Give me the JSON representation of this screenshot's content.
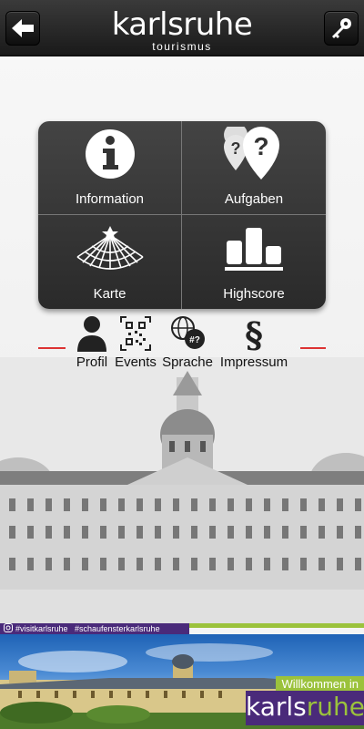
{
  "header": {
    "back_icon": "arrow-left-icon",
    "logo_main": "karlsruhe",
    "logo_sub": "tourismus",
    "key_icon": "key-icon"
  },
  "menu": {
    "tiles": [
      {
        "label": "Information",
        "icon": "info-icon"
      },
      {
        "label": "Aufgaben",
        "icon": "question-pins-icon"
      },
      {
        "label": "Karte",
        "icon": "fan-map-icon"
      },
      {
        "label": "Highscore",
        "icon": "podium-icon"
      }
    ]
  },
  "iconrow": {
    "items": [
      {
        "label": "Profil",
        "icon": "person-icon"
      },
      {
        "label": "Events",
        "icon": "qr-code-icon"
      },
      {
        "label": "Sprache",
        "icon": "language-globe-icon"
      },
      {
        "label": "Impressum",
        "icon": "section-sign-icon"
      }
    ]
  },
  "social": {
    "hashtags": "#visitkarlsruhe   #schaufensterkarlsruhe",
    "instagram_icon": "instagram-icon"
  },
  "banner": {
    "welcome": "Willkommen in",
    "brand_part1": "karls",
    "brand_part2": "ruhe"
  },
  "colors": {
    "header_bg": "#222222",
    "tile_bg": "#3a3a3a",
    "accent_red": "#dd3333",
    "brand_purple": "#4a2a7a",
    "brand_green": "#9bc23c"
  }
}
